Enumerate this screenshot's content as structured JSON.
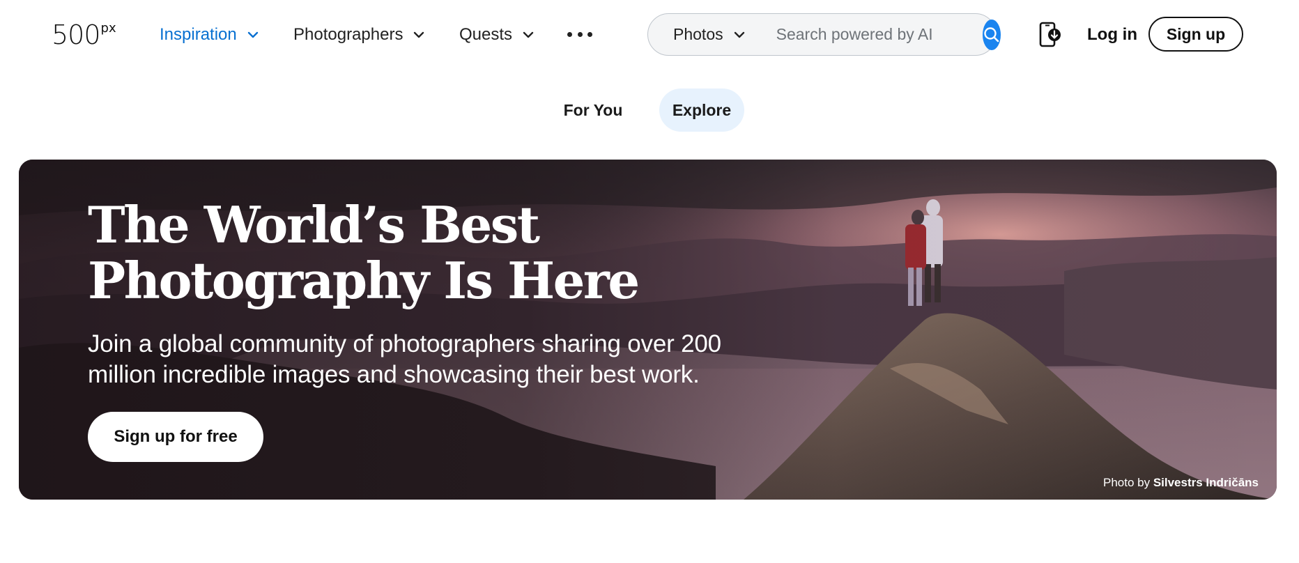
{
  "header": {
    "logo": {
      "main": "500",
      "sup": "px"
    },
    "nav": [
      {
        "label": "Inspiration",
        "active": true
      },
      {
        "label": "Photographers",
        "active": false
      },
      {
        "label": "Quests",
        "active": false
      }
    ],
    "search": {
      "type_label": "Photos",
      "placeholder": "Search powered by AI"
    },
    "login_label": "Log in",
    "signup_label": "Sign up"
  },
  "tabs": [
    {
      "label": "For You",
      "active": false
    },
    {
      "label": "Explore",
      "active": true
    }
  ],
  "hero": {
    "title_line1": "The World’s Best",
    "title_line2": "Photography Is Here",
    "subtitle_line1": "Join a global community of photographers sharing over 200",
    "subtitle_line2": "million incredible images and showcasing their best work.",
    "cta_label": "Sign up for free",
    "credit_prefix": "Photo by",
    "credit_name": "Silvestrs Indričāns"
  },
  "colors": {
    "accent": "#0870d1",
    "search_button": "#1a84ef",
    "explore_tab_bg": "#e7f2fd"
  },
  "icons": {
    "nav_chevron": "chevron-down-icon",
    "more": "more-dots-icon",
    "search": "search-icon",
    "app": "phone-download-icon"
  }
}
